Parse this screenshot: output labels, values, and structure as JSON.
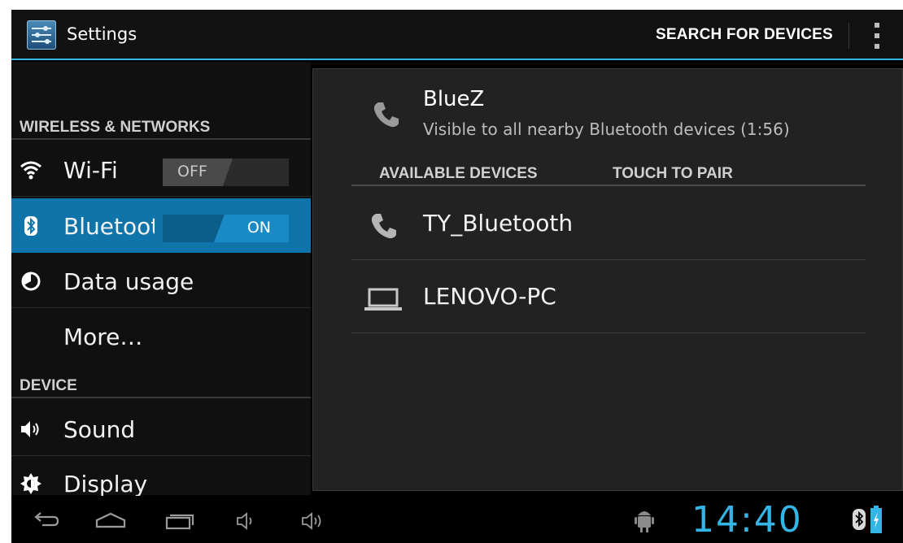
{
  "action_bar": {
    "title": "Settings",
    "search_label": "SEARCH FOR DEVICES"
  },
  "left_pane": {
    "sections": [
      {
        "header": "WIRELESS & NETWORKS"
      },
      {
        "header": "DEVICE"
      }
    ],
    "items": [
      {
        "label": "Wi-Fi",
        "icon": "wifi-icon",
        "toggle": "OFF"
      },
      {
        "label": "Bluetooth",
        "icon": "bluetooth-icon",
        "toggle": "ON",
        "selected": true
      },
      {
        "label": "Data usage",
        "icon": "data-usage-icon"
      },
      {
        "label": "More…"
      },
      {
        "label": "Sound",
        "icon": "sound-icon"
      },
      {
        "label": "Display",
        "icon": "display-icon"
      }
    ]
  },
  "right_pane": {
    "local_device": {
      "name": "BlueZ",
      "status": "Visible to all nearby Bluetooth devices (1:56)"
    },
    "available_header": "AVAILABLE DEVICES",
    "touch_header": "TOUCH TO PAIR",
    "devices": [
      {
        "name": "TY_Bluetooth",
        "icon": "phone-icon"
      },
      {
        "name": "LENOVO-PC",
        "icon": "laptop-icon"
      }
    ]
  },
  "system_bar": {
    "clock": "14:40",
    "accent": "#33b5e5"
  },
  "colors": {
    "accent": "#33b5e5",
    "selected": "#0e74a9"
  }
}
